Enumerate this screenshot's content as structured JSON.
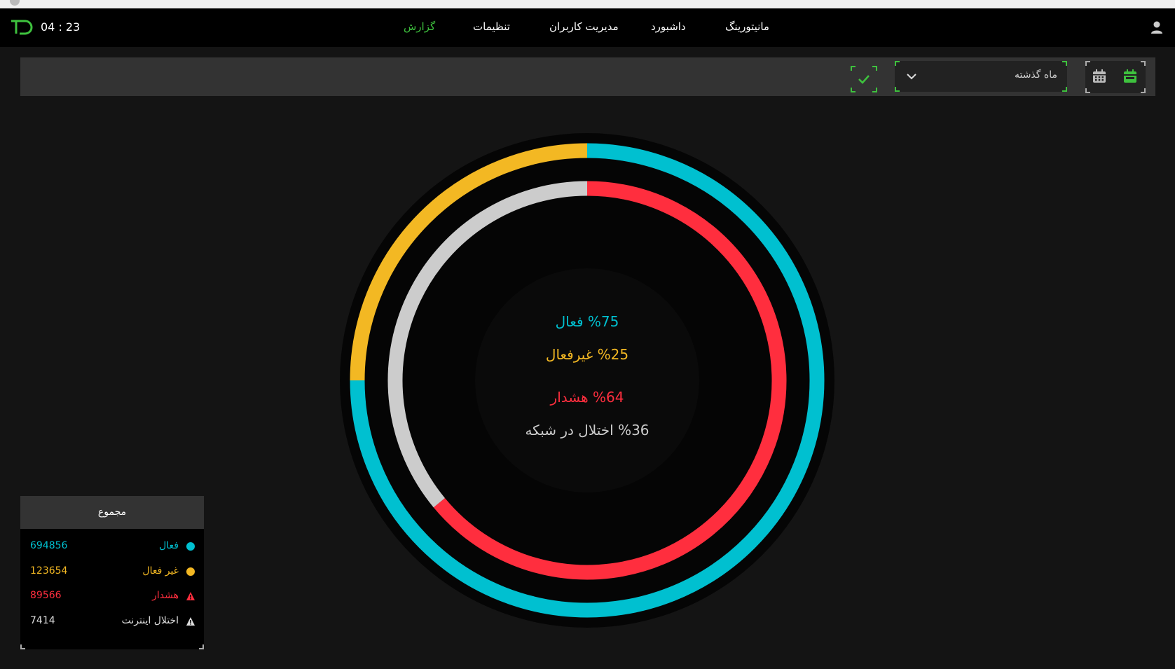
{
  "header": {
    "clock": "04 : 23",
    "nav": [
      {
        "label": "مانیتورینگ"
      },
      {
        "label": "داشبورد"
      },
      {
        "label": "مدیریت کاربران"
      },
      {
        "label": "تنظیمات"
      },
      {
        "label": "گزارش"
      }
    ]
  },
  "filter": {
    "period_value": "ماه گذشته"
  },
  "chart_data": {
    "type": "donut",
    "rings": [
      {
        "name": "outer",
        "segments": [
          {
            "label": "فعال",
            "percent": 75,
            "color": "#00c0d0"
          },
          {
            "label": "غیرفعال",
            "percent": 25,
            "color": "#f3b823"
          }
        ]
      },
      {
        "name": "inner",
        "segments": [
          {
            "label": "هشدار",
            "percent": 64,
            "color": "#ff2e3e"
          },
          {
            "label": "اختلال در شبکه",
            "percent": 36,
            "color": "#cccccc"
          }
        ]
      }
    ]
  },
  "center_labels": {
    "active": "%75  فعال",
    "inactive": "%25  غیرفعال",
    "warning": "%64  هشدار",
    "network": "%36  اختلال در شبکه"
  },
  "summary": {
    "title": "مجموع",
    "rows": [
      {
        "label": "فعال",
        "value": "694856",
        "color": "#00c0d0",
        "icon": "dot-icon"
      },
      {
        "label": "غیر فعال",
        "value": "123654",
        "color": "#f3b823",
        "icon": "dot-icon"
      },
      {
        "label": "هشدار",
        "value": "89566",
        "color": "#ff2e3e",
        "icon": "warning-icon"
      },
      {
        "label": "اختلال اینترنت",
        "value": "7414",
        "color": "#dddddd",
        "icon": "warning-icon"
      }
    ]
  },
  "colors": {
    "accent": "#3ec23e",
    "active": "#00c0d0",
    "inactive": "#f3b823",
    "warning": "#ff2e3e",
    "network": "#cccccc"
  }
}
